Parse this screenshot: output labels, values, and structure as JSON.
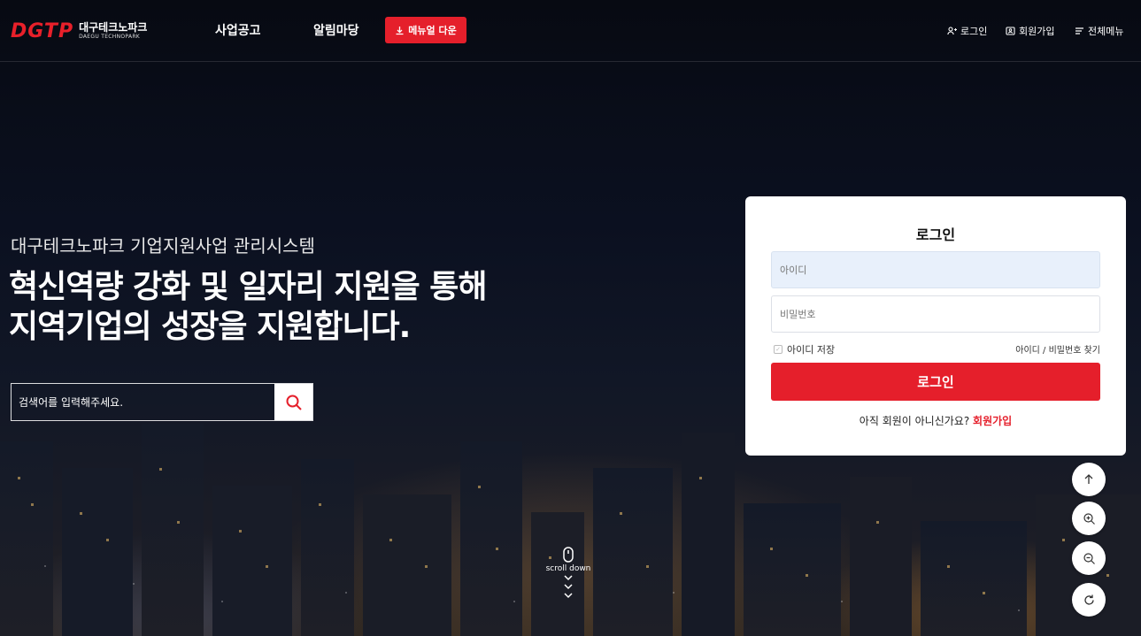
{
  "header": {
    "logo_mark": "DGTP",
    "logo_korean": "대구테크노파크",
    "logo_english": "DAEGU TECHNOPARK",
    "nav": [
      {
        "label": "사업공고"
      },
      {
        "label": "알림마당"
      }
    ],
    "manual_button": "메뉴얼 다운",
    "util": {
      "login": "로그인",
      "signup": "회원가입",
      "all_menu": "전체메뉴"
    }
  },
  "hero": {
    "subtitle": "대구테크노파크 기업지원사업 관리시스템",
    "headline_line1": "혁신역량 강화 및 일자리 지원을 통해",
    "headline_line2": "지역기업의 성장을 지원합니다.",
    "search_placeholder": "검색어를 입력해주세요."
  },
  "login": {
    "title": "로그인",
    "id_placeholder": "아이디",
    "pw_placeholder": "비밀번호",
    "save_id": "아이디 저장",
    "find": "아이디 / 비밀번호 찾기",
    "submit": "로그인",
    "join_prompt": "아직 회원이 아니신가요?",
    "join_link": "회원가입"
  },
  "scroll": {
    "label": "scroll down"
  },
  "floating": [
    {
      "icon": "arrow-up-icon"
    },
    {
      "icon": "zoom-in-icon"
    },
    {
      "icon": "zoom-out-icon"
    },
    {
      "icon": "refresh-icon"
    }
  ],
  "colors": {
    "brand_red": "#e51f2b",
    "id_field_bg": "#e8f0fb"
  }
}
